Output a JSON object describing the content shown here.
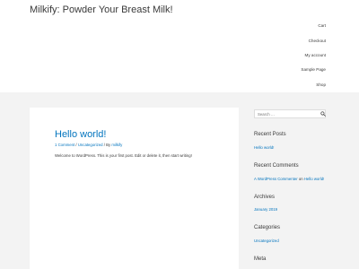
{
  "header": {
    "site_title": "Milkify: Powder Your Breast Milk!",
    "nav": [
      "Cart",
      "Checkout",
      "My account",
      "Sample Page",
      "Shop"
    ]
  },
  "post": {
    "title": "Hello world!",
    "meta": {
      "comments": "1 Comment",
      "separator": " / ",
      "category": "Uncategorized",
      "by": "By",
      "author": "milkify"
    },
    "excerpt": "Welcome to WordPress. This is your first post. Edit or delete it, then start writing!"
  },
  "sidebar": {
    "search_placeholder": "Search …",
    "recent_posts": {
      "title": "Recent Posts",
      "items": [
        "Hello world!"
      ]
    },
    "recent_comments": {
      "title": "Recent Comments",
      "author": "A WordPress Commenter",
      "on": "on",
      "post": "Hello world!"
    },
    "archives": {
      "title": "Archives",
      "items": [
        "January 2019"
      ]
    },
    "categories": {
      "title": "Categories",
      "items": [
        "Uncategorized"
      ]
    },
    "meta": {
      "title": "Meta"
    }
  }
}
